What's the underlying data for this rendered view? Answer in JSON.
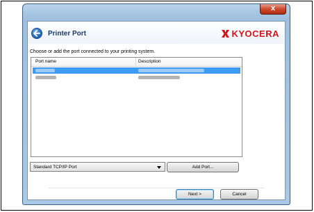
{
  "window": {
    "close_glyph": "x"
  },
  "header": {
    "title": "Printer Port",
    "brand": "KYOCERA",
    "brand_color": "#d2141b"
  },
  "instruction": "Choose or add the port connected to your printing system.",
  "port_list": {
    "columns": [
      "Port name",
      "Description"
    ],
    "rows": [
      {
        "name": "",
        "description": "",
        "selected": true,
        "redacted": true
      },
      {
        "name": "",
        "description": "",
        "selected": false,
        "redacted": true
      }
    ],
    "selection_color": "#3d9bf2"
  },
  "port_type": {
    "selected": "Standard TCP/IP Port"
  },
  "buttons": {
    "add_port": "Add Port...",
    "next": "Next >",
    "cancel": "Cancel"
  },
  "icons": {
    "back": "back-arrow-icon",
    "close": "close-icon",
    "dropdown": "chevron-down-icon",
    "logo": "kyocera-logo-icon"
  }
}
